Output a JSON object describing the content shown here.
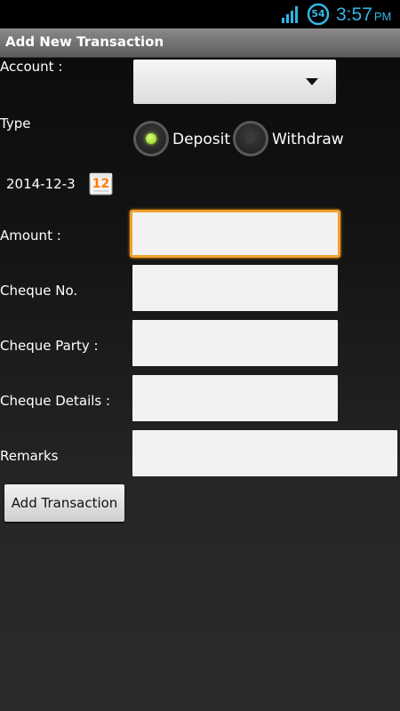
{
  "status_bar": {
    "battery_level": "54",
    "time": "3:57",
    "ampm": "PM",
    "icons": [
      "signal-icon",
      "battery-icon"
    ],
    "accent_color": "#33b5e5"
  },
  "title": "Add New Transaction",
  "form": {
    "account_label": "Account :",
    "account_value": "",
    "type_label": "Type",
    "type_options": [
      {
        "label": "Deposit",
        "selected": true
      },
      {
        "label": "Withdraw",
        "selected": false
      }
    ],
    "date": "2014-12-3",
    "calendar_icon_text": "12",
    "amount_label": "Amount :",
    "amount_value": "",
    "cheque_no_label": "Cheque No.",
    "cheque_no_value": "",
    "cheque_party_label": "Cheque Party :",
    "cheque_party_value": "",
    "cheque_details_label": "Cheque Details :",
    "cheque_details_value": "",
    "remarks_label": "Remarks",
    "remarks_value": "",
    "submit_label": "Add Transaction",
    "focus_color": "#f0a030"
  }
}
